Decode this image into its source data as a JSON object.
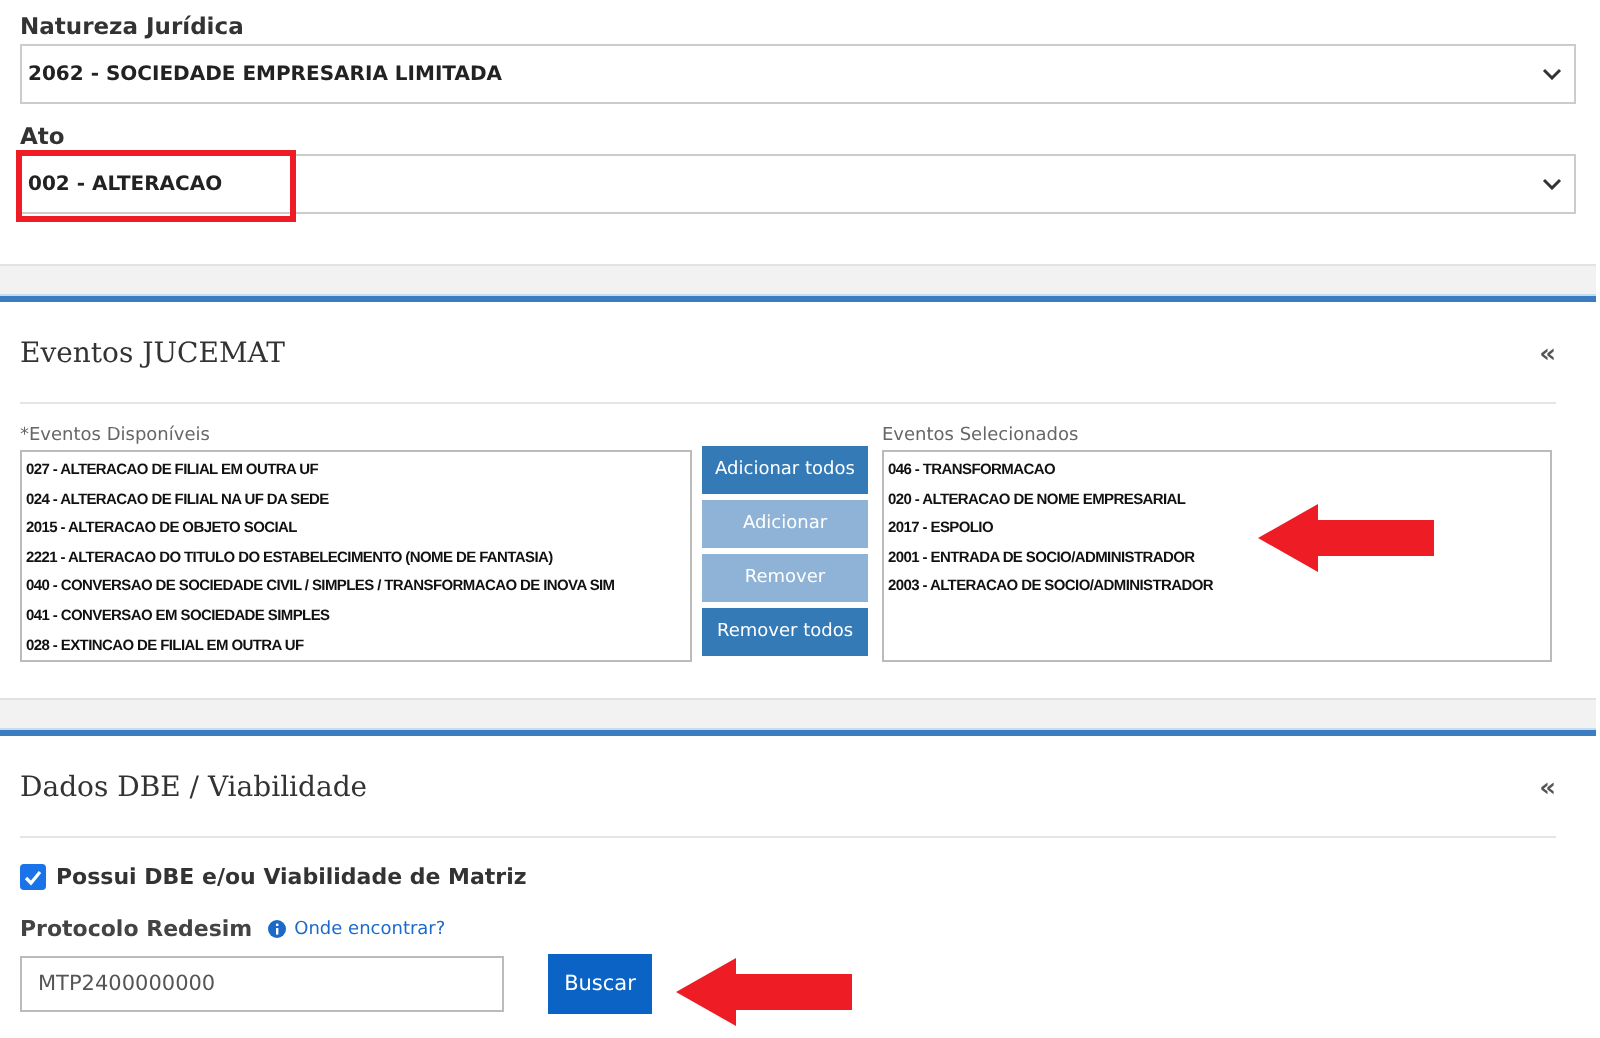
{
  "form": {
    "fields": [
      {
        "label": "Natureza Jurídica",
        "value": "2062 - SOCIEDADE EMPRESARIA LIMITADA",
        "highlighted": false
      },
      {
        "label": "Ato",
        "value": "002 - ALTERACAO",
        "highlighted": true
      }
    ]
  },
  "eventos": {
    "title": "Eventos JUCEMAT",
    "collapse": "«",
    "available": {
      "label": "*Eventos Disponíveis",
      "items": [
        "027 - ALTERACAO DE FILIAL EM OUTRA UF",
        "024 - ALTERACAO DE FILIAL NA UF DA SEDE",
        "2015 - ALTERACAO DE OBJETO SOCIAL",
        "2221 - ALTERACAO DO TITULO DO ESTABELECIMENTO (NOME DE FANTASIA)",
        "040 - CONVERSAO DE SOCIEDADE CIVIL / SIMPLES / TRANSFORMACAO DE INOVA SIM",
        "041 - CONVERSAO EM SOCIEDADE SIMPLES",
        "028 - EXTINCAO DE FILIAL EM OUTRA UF"
      ]
    },
    "buttons": [
      {
        "label": "Adicionar todos",
        "disabled": false
      },
      {
        "label": "Adicionar",
        "disabled": true
      },
      {
        "label": "Remover",
        "disabled": true
      },
      {
        "label": "Remover todos",
        "disabled": false
      }
    ],
    "selected": {
      "label": "Eventos Selecionados",
      "items": [
        "046 - TRANSFORMACAO",
        "020 - ALTERACAO DE NOME EMPRESARIAL",
        "2017 - ESPOLIO",
        "2001 - ENTRADA DE SOCIO/ADMINISTRADOR",
        "2003 - ALTERACAO DE SOCIO/ADMINISTRADOR"
      ]
    }
  },
  "dbe": {
    "title": "Dados DBE / Viabilidade",
    "collapse": "«",
    "checkbox": {
      "label": "Possui DBE e/ou Viabilidade de Matriz",
      "checked": true
    },
    "protocolo": {
      "label": "Protocolo Redesim",
      "help": "Onde encontrar?",
      "value": "MTP2400000000"
    },
    "button": "Buscar"
  }
}
